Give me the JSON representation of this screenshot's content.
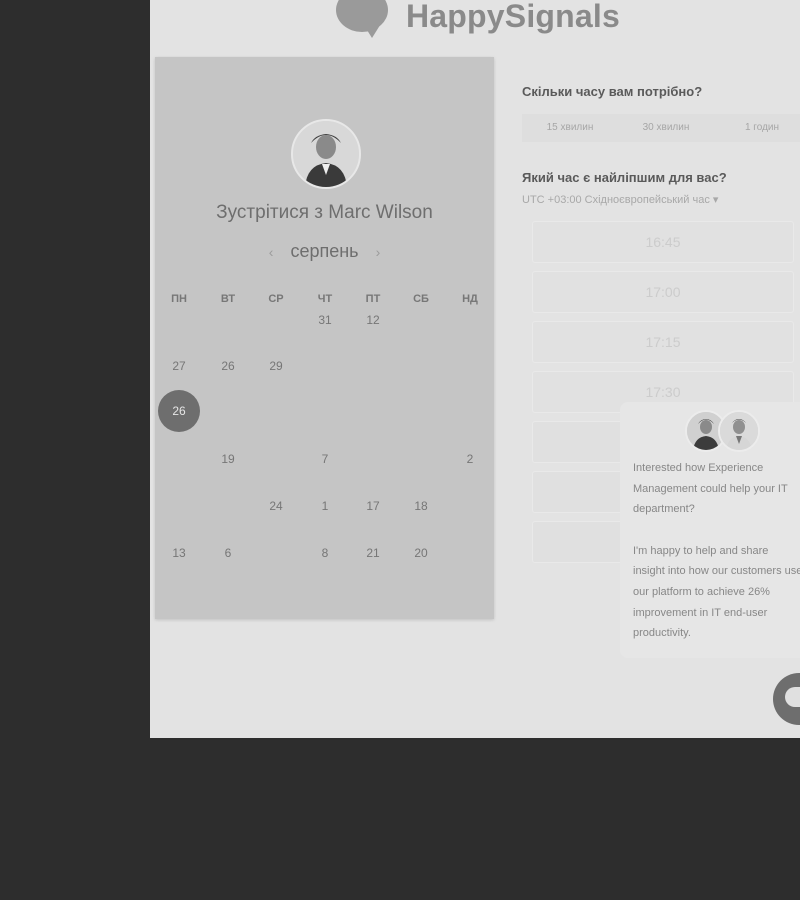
{
  "brand": {
    "name": "HappySignals"
  },
  "host": {
    "title": "Зустрітися з Marc Wilson"
  },
  "calendar": {
    "month": "серпень",
    "prev_icon": "‹",
    "next_icon": "›",
    "weekdays": [
      "ПН",
      "ВТ",
      "СР",
      "ЧТ",
      "ПТ",
      "СБ",
      "НД"
    ],
    "weeks": [
      [
        "",
        "",
        "",
        "31",
        "12",
        "",
        ""
      ],
      [
        "27",
        "26",
        "29",
        "",
        "",
        "",
        ""
      ],
      [
        "26",
        "",
        "",
        "",
        "",
        "",
        ""
      ],
      [
        "",
        "19",
        "",
        "7",
        "",
        "",
        "2"
      ],
      [
        "",
        "",
        "24",
        "1",
        "17",
        "18",
        ""
      ],
      [
        "13",
        "6",
        "",
        "8",
        "21",
        "20",
        ""
      ]
    ],
    "selected_day": "26"
  },
  "duration": {
    "question": "Скільки часу вам потрібно?",
    "options": [
      "15 хвилин",
      "30 хвилин",
      "1 годин"
    ]
  },
  "time": {
    "question": "Який час є найліпшим для вас?",
    "timezone": "UTC +03:00 Східноєвропейський час",
    "timezone_caret": "▾",
    "slots": [
      "16:45",
      "17:00",
      "17:15",
      "17:30",
      "",
      "",
      ""
    ]
  },
  "chat": {
    "message_1": "Interested how Experience Management could help your IT department?",
    "message_2": "I'm happy to help and share insight into how our customers use our platform to achieve 26% improvement in IT end-user productivity."
  },
  "colors": {
    "overlay": "#2d2d2d",
    "selected": "#6e6e6e",
    "panel": "#c5c5c5"
  }
}
